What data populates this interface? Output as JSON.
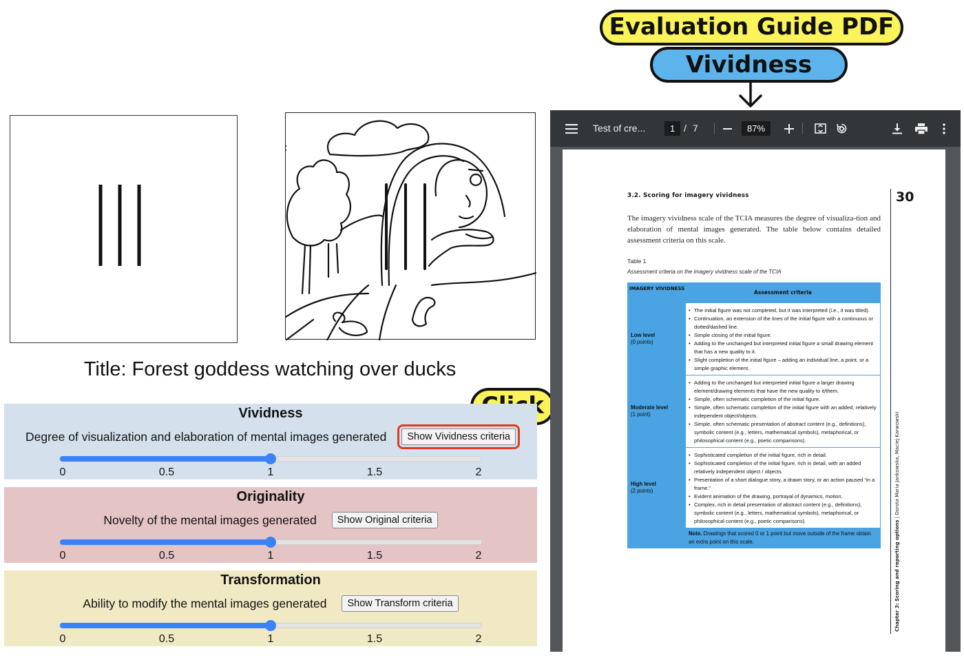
{
  "callouts": {
    "guide": "Evaluation Guide PDF",
    "criterion": "Vividness",
    "click": "Click"
  },
  "drawing": {
    "title": "Title: Forest goddess watching over ducks"
  },
  "panels": [
    {
      "title": "Vividness",
      "description": "Degree of visualization and elaboration of mental images generated",
      "button": "Show Vividness criteria",
      "value": 1,
      "min": 0,
      "max": 2,
      "ticks": [
        "0",
        "0.5",
        "1",
        "1.5",
        "2"
      ]
    },
    {
      "title": "Originality",
      "description": "Novelty of the mental images generated",
      "button": "Show Original criteria",
      "value": 1,
      "min": 0,
      "max": 2,
      "ticks": [
        "0",
        "0.5",
        "1",
        "1.5",
        "2"
      ]
    },
    {
      "title": "Transformation",
      "description": "Ability to modify the mental images generated",
      "button": "Show Transform criteria",
      "value": 1,
      "min": 0,
      "max": 2,
      "ticks": [
        "0",
        "0.5",
        "1",
        "1.5",
        "2"
      ]
    }
  ],
  "pdf": {
    "doc_title": "Test of cre...",
    "page_current": "1",
    "page_sep": "/",
    "page_total": "7",
    "zoom": "87%",
    "icons": [
      "menu-icon",
      "zoom-out-icon",
      "zoom-in-icon",
      "fit-page-icon",
      "rotate-icon",
      "download-icon",
      "print-icon",
      "more-icon"
    ],
    "section_heading": "3.2. Scoring for imagery vividness",
    "page_number": "30",
    "intro": "The imagery vividness scale of the TCIA measures the degree of visualiza-tion and elaboration of mental images generated. The table below contains detailed assessment criteria on this scale.",
    "table_label": "Table 1",
    "table_caption": "Assessment criteria on the imagery vividness scale of the TCIA",
    "table_head_left": "IMAGERY VIVIDNESS",
    "table_head_right": "Assessment criteria",
    "levels": [
      {
        "name": "Low level",
        "points": "(0 points)",
        "criteria": [
          "The initial figure was not completed, but it was interpreted (i.e., it was titled).",
          "Continuation, an extension of the lines of the initial figure with a continuous or dotted/dashed line.",
          "Simple closing of the initial figure.",
          "Adding to the unchanged but interpreted initial figure a small drawing element that has a new quality to it.",
          "Slight completion of the initial figure – adding an individual line, a point, or a simple graphic element."
        ]
      },
      {
        "name": "Moderate level",
        "points": "(1 point)",
        "criteria": [
          "Adding to the unchanged but interpreted initial figure a larger drawing element/drawing elements that have the new quality to it/them.",
          "Simple, often schematic completion of the initial figure.",
          "Simple, often schematic completion of the initial figure with an added, relatively independent object/objects.",
          "Simple, often schematic presentation of abstract content (e.g., definitions), symbolic content (e.g., letters, mathematical symbols), metaphorical, or philosophical content (e.g., poetic comparisons)."
        ]
      },
      {
        "name": "High level",
        "points": "(2 points)",
        "criteria": [
          "Sophisticated completion of the initial figure, rich in detail.",
          "Sophisticated completion of the initial figure, rich in detail, with an added relatively independent object / objects.",
          "Presentation of a short dialogue story, a drawn story, or an action paused “in a frame.”",
          "Evident animation of the drawing, portrayal of dynamics, motion.",
          "Complex, rich in detail presentation of abstract content (e.g., definitions), symbolic content (e.g., letters, mathematical symbols), metaphorical, or philosophical content (e.g., poetic comparisons)."
        ]
      }
    ],
    "note_label": "Note.",
    "note_text": " Drawings that scored 0 or 1 point but move outside of the frame obtain an extra point on this scale.",
    "side_chapter_bold": "Chapter 3: Scoring and reporting options",
    "side_chapter_rest": " | Dorota Maria Jankowska, Maciej Karwowski"
  }
}
